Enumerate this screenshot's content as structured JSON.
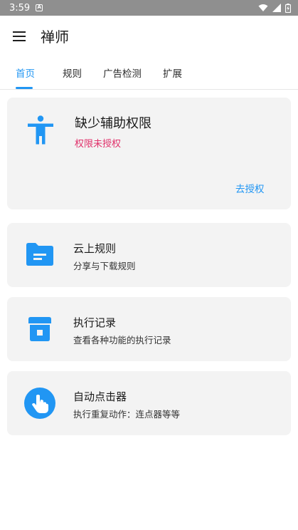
{
  "status_bar": {
    "time": "3:59",
    "notification": "A"
  },
  "app_bar": {
    "title": "禅师"
  },
  "tabs": [
    {
      "label": "首页",
      "active": true
    },
    {
      "label": "规则",
      "active": false
    },
    {
      "label": "广告检测",
      "active": false
    },
    {
      "label": "扩展",
      "active": false
    }
  ],
  "accessibility_card": {
    "title": "缺少辅助权限",
    "status": "权限未授权",
    "action_label": "去授权"
  },
  "cards": [
    {
      "title": "云上规则",
      "subtitle": "分享与下载规则",
      "icon": "folder-icon"
    },
    {
      "title": "执行记录",
      "subtitle": "查看各种功能的执行记录",
      "icon": "archive-icon"
    },
    {
      "title": "自动点击器",
      "subtitle": "执行重复动作：连点器等等",
      "icon": "touch-icon"
    }
  ],
  "colors": {
    "accent": "#2196f3",
    "warning": "#e0306a",
    "card_bg": "#f3f3f3",
    "status_bar": "#8f8f8f"
  }
}
